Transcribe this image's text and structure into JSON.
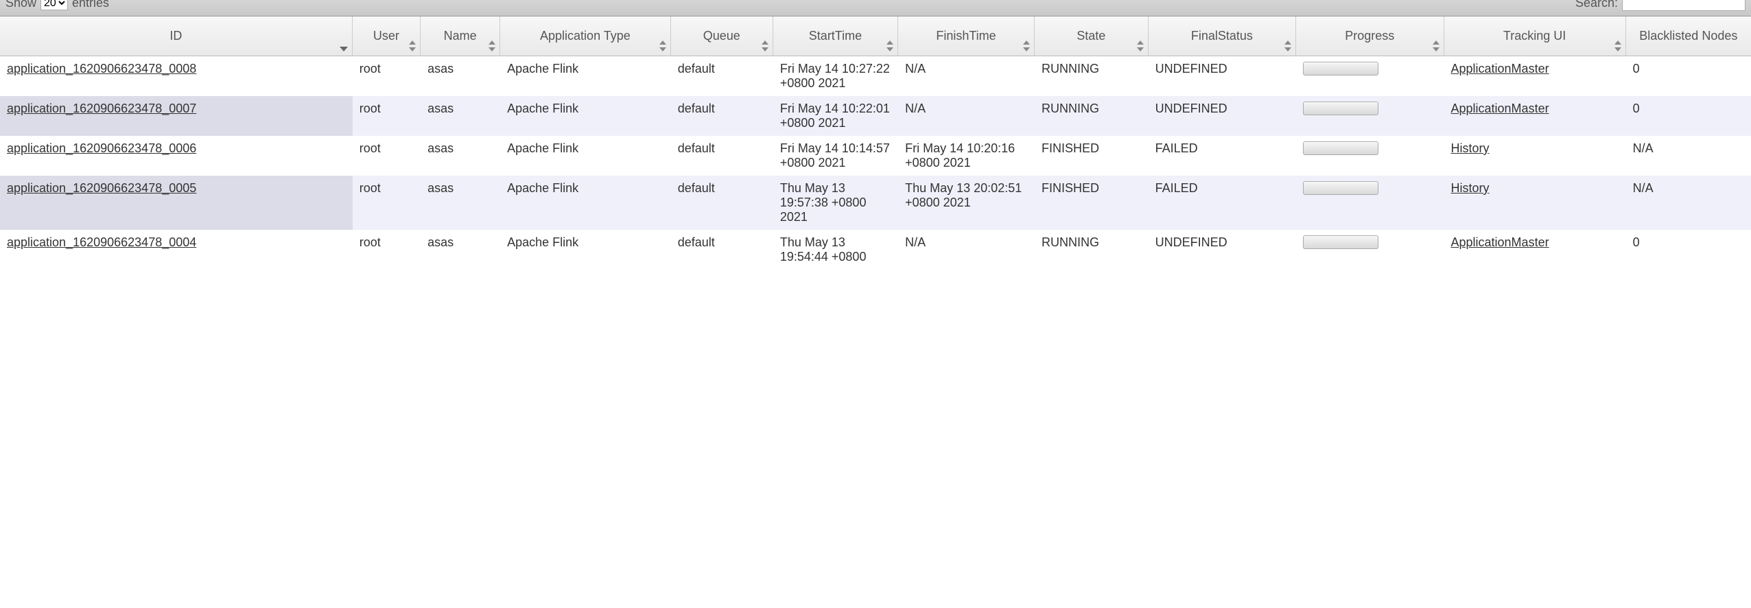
{
  "toolbar": {
    "show_label": "Show",
    "entries_label": "entries",
    "page_size": "20",
    "search_label": "Search:"
  },
  "columns": {
    "id": "ID",
    "user": "User",
    "name": "Name",
    "apptype": "Application Type",
    "queue": "Queue",
    "start": "StartTime",
    "finish": "FinishTime",
    "state": "State",
    "final": "FinalStatus",
    "progress": "Progress",
    "track": "Tracking UI",
    "black": "Blacklisted Nodes"
  },
  "rows": [
    {
      "id": "application_1620906623478_0008",
      "user": "root",
      "name": "asas",
      "apptype": "Apache Flink",
      "queue": "default",
      "start": "Fri May 14 10:27:22 +0800 2021",
      "finish": "N/A",
      "state": "RUNNING",
      "final": "UNDEFINED",
      "track": "ApplicationMaster",
      "black": "0"
    },
    {
      "id": "application_1620906623478_0007",
      "user": "root",
      "name": "asas",
      "apptype": "Apache Flink",
      "queue": "default",
      "start": "Fri May 14 10:22:01 +0800 2021",
      "finish": "N/A",
      "state": "RUNNING",
      "final": "UNDEFINED",
      "track": "ApplicationMaster",
      "black": "0"
    },
    {
      "id": "application_1620906623478_0006",
      "user": "root",
      "name": "asas",
      "apptype": "Apache Flink",
      "queue": "default",
      "start": "Fri May 14 10:14:57 +0800 2021",
      "finish": "Fri May 14 10:20:16 +0800 2021",
      "state": "FINISHED",
      "final": "FAILED",
      "track": "History",
      "black": "N/A"
    },
    {
      "id": "application_1620906623478_0005",
      "user": "root",
      "name": "asas",
      "apptype": "Apache Flink",
      "queue": "default",
      "start": "Thu May 13 19:57:38 +0800 2021",
      "finish": "Thu May 13 20:02:51 +0800 2021",
      "state": "FINISHED",
      "final": "FAILED",
      "track": "History",
      "black": "N/A"
    },
    {
      "id": "application_1620906623478_0004",
      "user": "root",
      "name": "asas",
      "apptype": "Apache Flink",
      "queue": "default",
      "start": "Thu May 13 19:54:44 +0800",
      "finish": "N/A",
      "state": "RUNNING",
      "final": "UNDEFINED",
      "track": "ApplicationMaster",
      "black": "0"
    }
  ]
}
